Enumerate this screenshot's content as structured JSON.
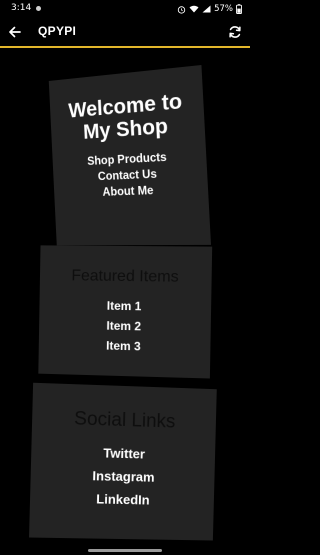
{
  "status_bar": {
    "time": "3:14",
    "battery": "57%"
  },
  "app_bar": {
    "title": "QPYPI",
    "back_icon": "arrow-left-icon",
    "refresh_icon": "refresh-icon",
    "accent_color": "#e2b62b"
  },
  "welcome_card": {
    "title_line1": "Welcome to",
    "title_line2": "My Shop",
    "links": [
      {
        "label": "Shop Products"
      },
      {
        "label": "Contact Us"
      },
      {
        "label": "About Me"
      }
    ]
  },
  "featured_card": {
    "title": "Featured Items",
    "items": [
      {
        "label": "Item 1"
      },
      {
        "label": "Item 2"
      },
      {
        "label": "Item 3"
      }
    ]
  },
  "social_card": {
    "title": "Social Links",
    "links": [
      {
        "label": "Twitter"
      },
      {
        "label": "Instagram"
      },
      {
        "label": "LinkedIn"
      }
    ]
  }
}
